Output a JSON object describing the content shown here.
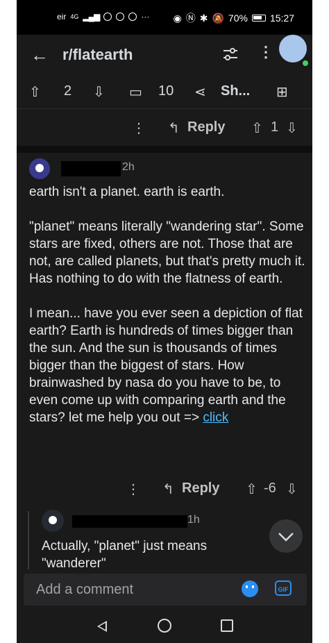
{
  "status_bar": {
    "carrier": "eir",
    "network": "4G",
    "battery_percent": "70%",
    "time": "15:27"
  },
  "header": {
    "back_icon": "arrow-left-icon",
    "title": "r/flatearth",
    "filter_icon": "sliders-icon",
    "more_icon": "kebab-icon"
  },
  "post_actions": {
    "upvotes": "2",
    "comments": "10",
    "share_label": "Sh..."
  },
  "comment1_footer": {
    "reply_label": "Reply",
    "score": "1"
  },
  "comment2": {
    "age": "2h",
    "paragraphs": [
      "earth isn't a planet. earth is earth.",
      "\"planet\" means literally \"wandering star\". Some stars are fixed, others are not. Those that are not, are called planets, but that's pretty much it. Has nothing to do with the flatness of earth."
    ],
    "last_paragraph_text": "I mean... have you ever seen a depiction of flat earth? Earth is hundreds of times bigger than the sun. And the sun is thousands of times bigger than the biggest of stars. How brainwashed by nasa do you have to be, to even come up with comparing earth and the stars? let me help you out => ",
    "link_text": "click",
    "reply_label": "Reply",
    "score": "-6"
  },
  "comment3": {
    "age": "1h",
    "body": "Actually, \"planet\" just means \"wanderer\""
  },
  "composer": {
    "placeholder": "Add a comment",
    "gif_label": "GIF"
  },
  "colors": {
    "background": "#1a1a1b",
    "text": "#d7dadc",
    "link": "#4fbcff",
    "accent": "#2b8ef0"
  }
}
